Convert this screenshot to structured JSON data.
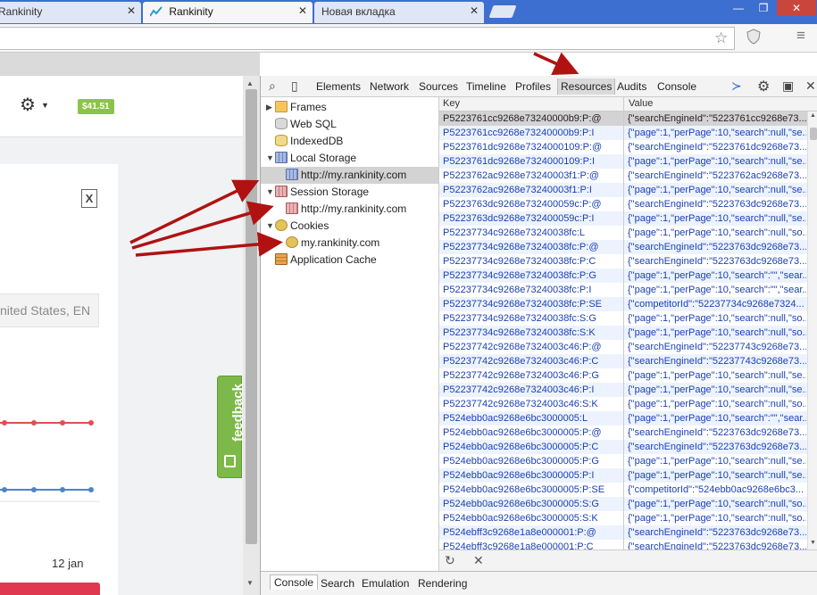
{
  "browser": {
    "tabs": [
      {
        "label": "Rankinity",
        "state": "inactive"
      },
      {
        "label": "Rankinity",
        "state": "active"
      },
      {
        "label": "Новая вкладка",
        "state": "inactive"
      }
    ],
    "close_glyph": "✕",
    "window_controls": {
      "minimize": "—",
      "maximize": "❐",
      "close": "✕"
    },
    "address_icons": [
      "star-icon",
      "shield-icon",
      "menu-icon"
    ]
  },
  "website": {
    "price_badge": "$41.51",
    "region_placeholder": "nited States, EN",
    "date_label": "12 jan",
    "feedback_label": "feedback",
    "chart_data": {
      "type": "line",
      "series": [
        {
          "color": "#d9534f",
          "values": [
            1,
            1,
            1,
            1
          ]
        },
        {
          "color": "#4a86c8",
          "values": [
            0,
            0,
            0,
            0
          ]
        }
      ]
    }
  },
  "devtools": {
    "toolbar_tabs": [
      "Elements",
      "Network",
      "Sources",
      "Timeline",
      "Profiles",
      "Resources",
      "Audits",
      "Console"
    ],
    "selected_tab": "Resources",
    "tree": [
      {
        "label": "Frames",
        "icon": "folder-icon",
        "arrow": "▶",
        "indent": 0,
        "selected": false
      },
      {
        "label": "Web SQL",
        "icon": "database-icon",
        "arrow": "",
        "indent": 0,
        "selected": false
      },
      {
        "label": "IndexedDB",
        "icon": "indexeddb-icon",
        "arrow": "",
        "indent": 0,
        "selected": false
      },
      {
        "label": "Local Storage",
        "icon": "local-storage-icon",
        "arrow": "▼",
        "indent": 0,
        "selected": false
      },
      {
        "label": "http://my.rankinity.com",
        "icon": "local-storage-icon",
        "arrow": "",
        "indent": 1,
        "selected": true
      },
      {
        "label": "Session Storage",
        "icon": "session-storage-icon",
        "arrow": "▼",
        "indent": 0,
        "selected": false
      },
      {
        "label": "http://my.rankinity.com",
        "icon": "session-storage-icon",
        "arrow": "",
        "indent": 1,
        "selected": false
      },
      {
        "label": "Cookies",
        "icon": "cookie-icon",
        "arrow": "▼",
        "indent": 0,
        "selected": false
      },
      {
        "label": "my.rankinity.com",
        "icon": "cookie-icon",
        "arrow": "",
        "indent": 1,
        "selected": false
      },
      {
        "label": "Application Cache",
        "icon": "app-cache-icon",
        "arrow": "",
        "indent": 0,
        "selected": false
      }
    ],
    "table": {
      "headers": {
        "key": "Key",
        "value": "Value"
      },
      "rows": [
        [
          "P5223761cc9268e73240000b9:P:@",
          "{\"searchEngineId\":\"5223761cc9268e73..."
        ],
        [
          "P5223761cc9268e73240000b9:P:I",
          "{\"page\":1,\"perPage\":10,\"search\":null,\"se..."
        ],
        [
          "P5223761dc9268e7324000109:P:@",
          "{\"searchEngineId\":\"5223761dc9268e73..."
        ],
        [
          "P5223761dc9268e7324000109:P:I",
          "{\"page\":1,\"perPage\":10,\"search\":null,\"se..."
        ],
        [
          "P5223762ac9268e73240003f1:P:@",
          "{\"searchEngineId\":\"5223762ac9268e73..."
        ],
        [
          "P5223762ac9268e73240003f1:P:I",
          "{\"page\":1,\"perPage\":10,\"search\":null,\"se..."
        ],
        [
          "P5223763dc9268e732400059c:P:@",
          "{\"searchEngineId\":\"5223763dc9268e73..."
        ],
        [
          "P5223763dc9268e732400059c:P:I",
          "{\"page\":1,\"perPage\":10,\"search\":null,\"se..."
        ],
        [
          "P52237734c9268e73240038fc:L",
          "{\"page\":1,\"perPage\":10,\"search\":null,\"so..."
        ],
        [
          "P52237734c9268e73240038fc:P:@",
          "{\"searchEngineId\":\"5223763dc9268e73..."
        ],
        [
          "P52237734c9268e73240038fc:P:C",
          "{\"searchEngineId\":\"5223763dc9268e73..."
        ],
        [
          "P52237734c9268e73240038fc:P:G",
          "{\"page\":1,\"perPage\":10,\"search\":\"\",\"sear..."
        ],
        [
          "P52237734c9268e73240038fc:P:I",
          "{\"page\":1,\"perPage\":10,\"search\":\"\",\"sear..."
        ],
        [
          "P52237734c9268e73240038fc:P:SE",
          "{\"competitorId\":\"52237734c9268e7324..."
        ],
        [
          "P52237734c9268e73240038fc:S:G",
          "{\"page\":1,\"perPage\":10,\"search\":null,\"so..."
        ],
        [
          "P52237734c9268e73240038fc:S:K",
          "{\"page\":1,\"perPage\":10,\"search\":null,\"so..."
        ],
        [
          "P52237742c9268e7324003c46:P:@",
          "{\"searchEngineId\":\"52237743c9268e73..."
        ],
        [
          "P52237742c9268e7324003c46:P:C",
          "{\"searchEngineId\":\"52237743c9268e73..."
        ],
        [
          "P52237742c9268e7324003c46:P:G",
          "{\"page\":1,\"perPage\":10,\"search\":null,\"se..."
        ],
        [
          "P52237742c9268e7324003c46:P:I",
          "{\"page\":1,\"perPage\":10,\"search\":null,\"se..."
        ],
        [
          "P52237742c9268e7324003c46:S:K",
          "{\"page\":1,\"perPage\":10,\"search\":null,\"so..."
        ],
        [
          "P524ebb0ac9268e6bc3000005:L",
          "{\"page\":1,\"perPage\":10,\"search\":\"\",\"sear..."
        ],
        [
          "P524ebb0ac9268e6bc3000005:P:@",
          "{\"searchEngineId\":\"5223763dc9268e73..."
        ],
        [
          "P524ebb0ac9268e6bc3000005:P:C",
          "{\"searchEngineId\":\"5223763dc9268e73..."
        ],
        [
          "P524ebb0ac9268e6bc3000005:P:G",
          "{\"page\":1,\"perPage\":10,\"search\":null,\"se..."
        ],
        [
          "P524ebb0ac9268e6bc3000005:P:I",
          "{\"page\":1,\"perPage\":10,\"search\":null,\"se..."
        ],
        [
          "P524ebb0ac9268e6bc3000005:P:SE",
          "{\"competitorId\":\"524ebb0ac9268e6bc3..."
        ],
        [
          "P524ebb0ac9268e6bc3000005:S:G",
          "{\"page\":1,\"perPage\":10,\"search\":null,\"so..."
        ],
        [
          "P524ebb0ac9268e6bc3000005:S:K",
          "{\"page\":1,\"perPage\":10,\"search\":null,\"so..."
        ],
        [
          "P524ebff3c9268e1a8e000001:P:@",
          "{\"searchEngineId\":\"5223763dc9268e73..."
        ],
        [
          "P524ebff3c9268e1a8e000001:P:C",
          "{\"searchEngineId\":\"5223763dc9268e73..."
        ]
      ]
    },
    "footer_icons": {
      "refresh": "↻",
      "delete": "✕"
    },
    "drawer_tabs": [
      "Console",
      "Search",
      "Emulation",
      "Rendering"
    ],
    "selected_drawer_tab": "Console",
    "colors": {
      "annotation_arrow": "#b01212",
      "link_blue": "#1a3fb5",
      "even_row": "#edf3fe"
    }
  }
}
